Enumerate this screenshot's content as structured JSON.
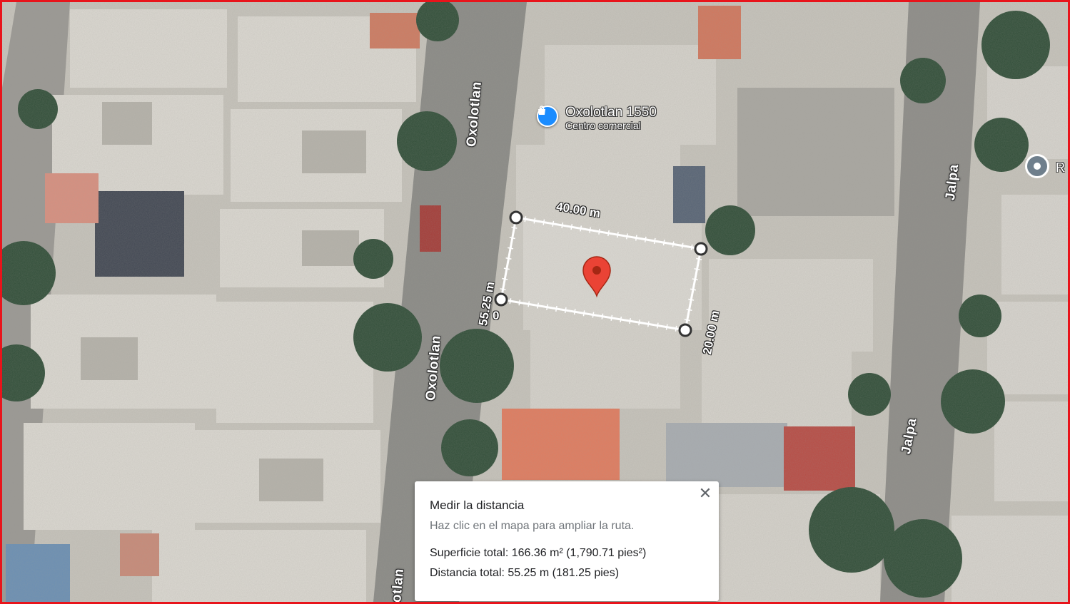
{
  "map": {
    "roads": [
      {
        "name": "Oxolotlan"
      },
      {
        "name": "Oxolotlan"
      },
      {
        "name": "otlan"
      },
      {
        "name": "Jalpa"
      },
      {
        "name": "Jalpa"
      }
    ],
    "poi": {
      "name": "Oxolotlan 1550",
      "category": "Centro comercial",
      "icon": "shopping-bag-icon",
      "color": "#1a8cff"
    },
    "poi_secondary": {
      "label": "R",
      "icon": "place-icon"
    },
    "measure": {
      "top_edge": "40.00 m",
      "right_edge": "20.00 m",
      "left_edge": "55.25 m",
      "start_label": "0",
      "line_color": "#ffffff"
    },
    "marker": {
      "icon": "red-pin-icon",
      "color": "#ea4335"
    }
  },
  "card": {
    "title": "Medir la distancia",
    "hint": "Haz clic en el mapa para ampliar la ruta.",
    "area": "Superficie total: 166.36 m² (1,790.71 pies²)",
    "distance": "Distancia total: 55.25 m (181.25 pies)",
    "close_icon": "close-icon"
  },
  "frame": {
    "border_color": "#e8141b"
  }
}
